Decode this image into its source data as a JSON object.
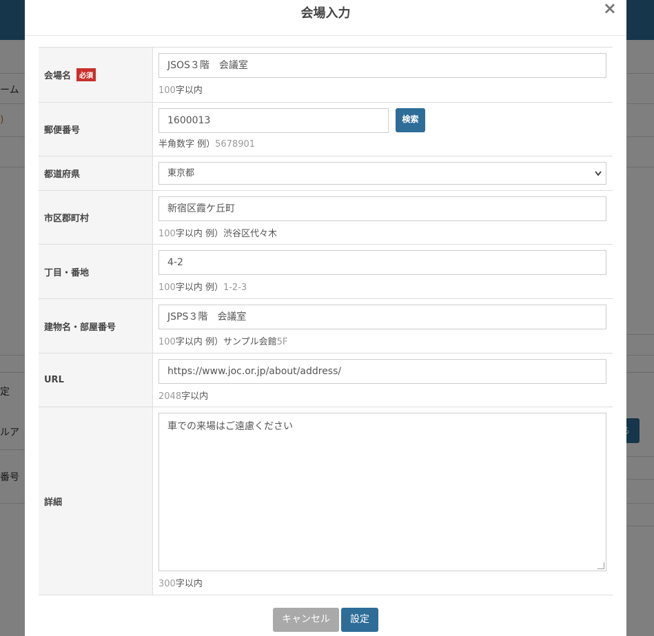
{
  "background": {
    "peek_texts": [
      "ーム",
      ")",
      "定",
      "ルア",
      "番号"
    ],
    "peek_button_label": "る"
  },
  "modal": {
    "title": "会場入力",
    "close_glyph": "×",
    "required_badge": "必須",
    "fields": {
      "venue_name": {
        "label": "会場名",
        "value": "JSOS３階　会議室",
        "hint_num": "100",
        "hint_text": "字以内"
      },
      "postal": {
        "label": "郵便番号",
        "value": "1600013",
        "search_label": "検索",
        "hint_text": "半角数字 例）",
        "hint_num": "5678901"
      },
      "prefecture": {
        "label": "都道府県",
        "selected": "東京都"
      },
      "city": {
        "label": "市区郡町村",
        "value": "新宿区霞ケ丘町",
        "hint_num": "100",
        "hint_text": "字以内 例）渋谷区代々木"
      },
      "address": {
        "label": "丁目・番地",
        "value": "4-2",
        "hint_num": "100",
        "hint_text": "字以内 例）",
        "hint_num2": "1-2-3"
      },
      "building": {
        "label": "建物名・部屋番号",
        "value": "JSPS３階　会議室",
        "hint_num": "100",
        "hint_text": "字以内 例）サンプル会館",
        "hint_num2": "5F"
      },
      "url": {
        "label": "URL",
        "value": "https://www.joc.or.jp/about/address/",
        "hint_num": "2048",
        "hint_text": "字以内"
      },
      "details": {
        "label": "詳細",
        "value": "車での来場はご遠慮ください",
        "hint_num": "300",
        "hint_text": "字以内"
      }
    },
    "cancel_label": "キャンセル",
    "submit_label": "設定"
  },
  "colors": {
    "primary": "#2d6d98",
    "required": "#c9302c",
    "cancel": "#a9a9a9"
  }
}
